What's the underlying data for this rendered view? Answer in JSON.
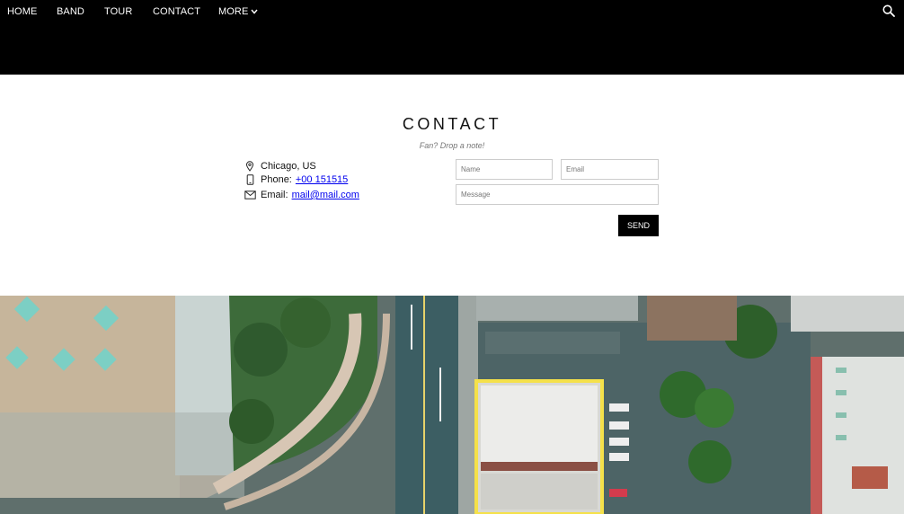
{
  "nav": {
    "items": [
      "HOME",
      "BAND",
      "TOUR",
      "CONTACT"
    ],
    "more_label": "MORE",
    "search_icon": "search-icon"
  },
  "contact": {
    "title": "CONTACT",
    "subtitle": "Fan? Drop a note!",
    "location": "Chicago, US",
    "phone_label": "Phone:",
    "phone": "+00 151515",
    "email_label": "Email:",
    "email": "mail@mail.com",
    "form": {
      "name_placeholder": "Name",
      "email_placeholder": "Email",
      "message_placeholder": "Message",
      "send_label": "SEND"
    }
  },
  "image": {
    "description_icon": "aerial-city-photo",
    "accent": "#f5e14a"
  },
  "colors": {
    "nav_bg": "#000000",
    "button_bg": "#000000",
    "link": "#0000ee"
  }
}
